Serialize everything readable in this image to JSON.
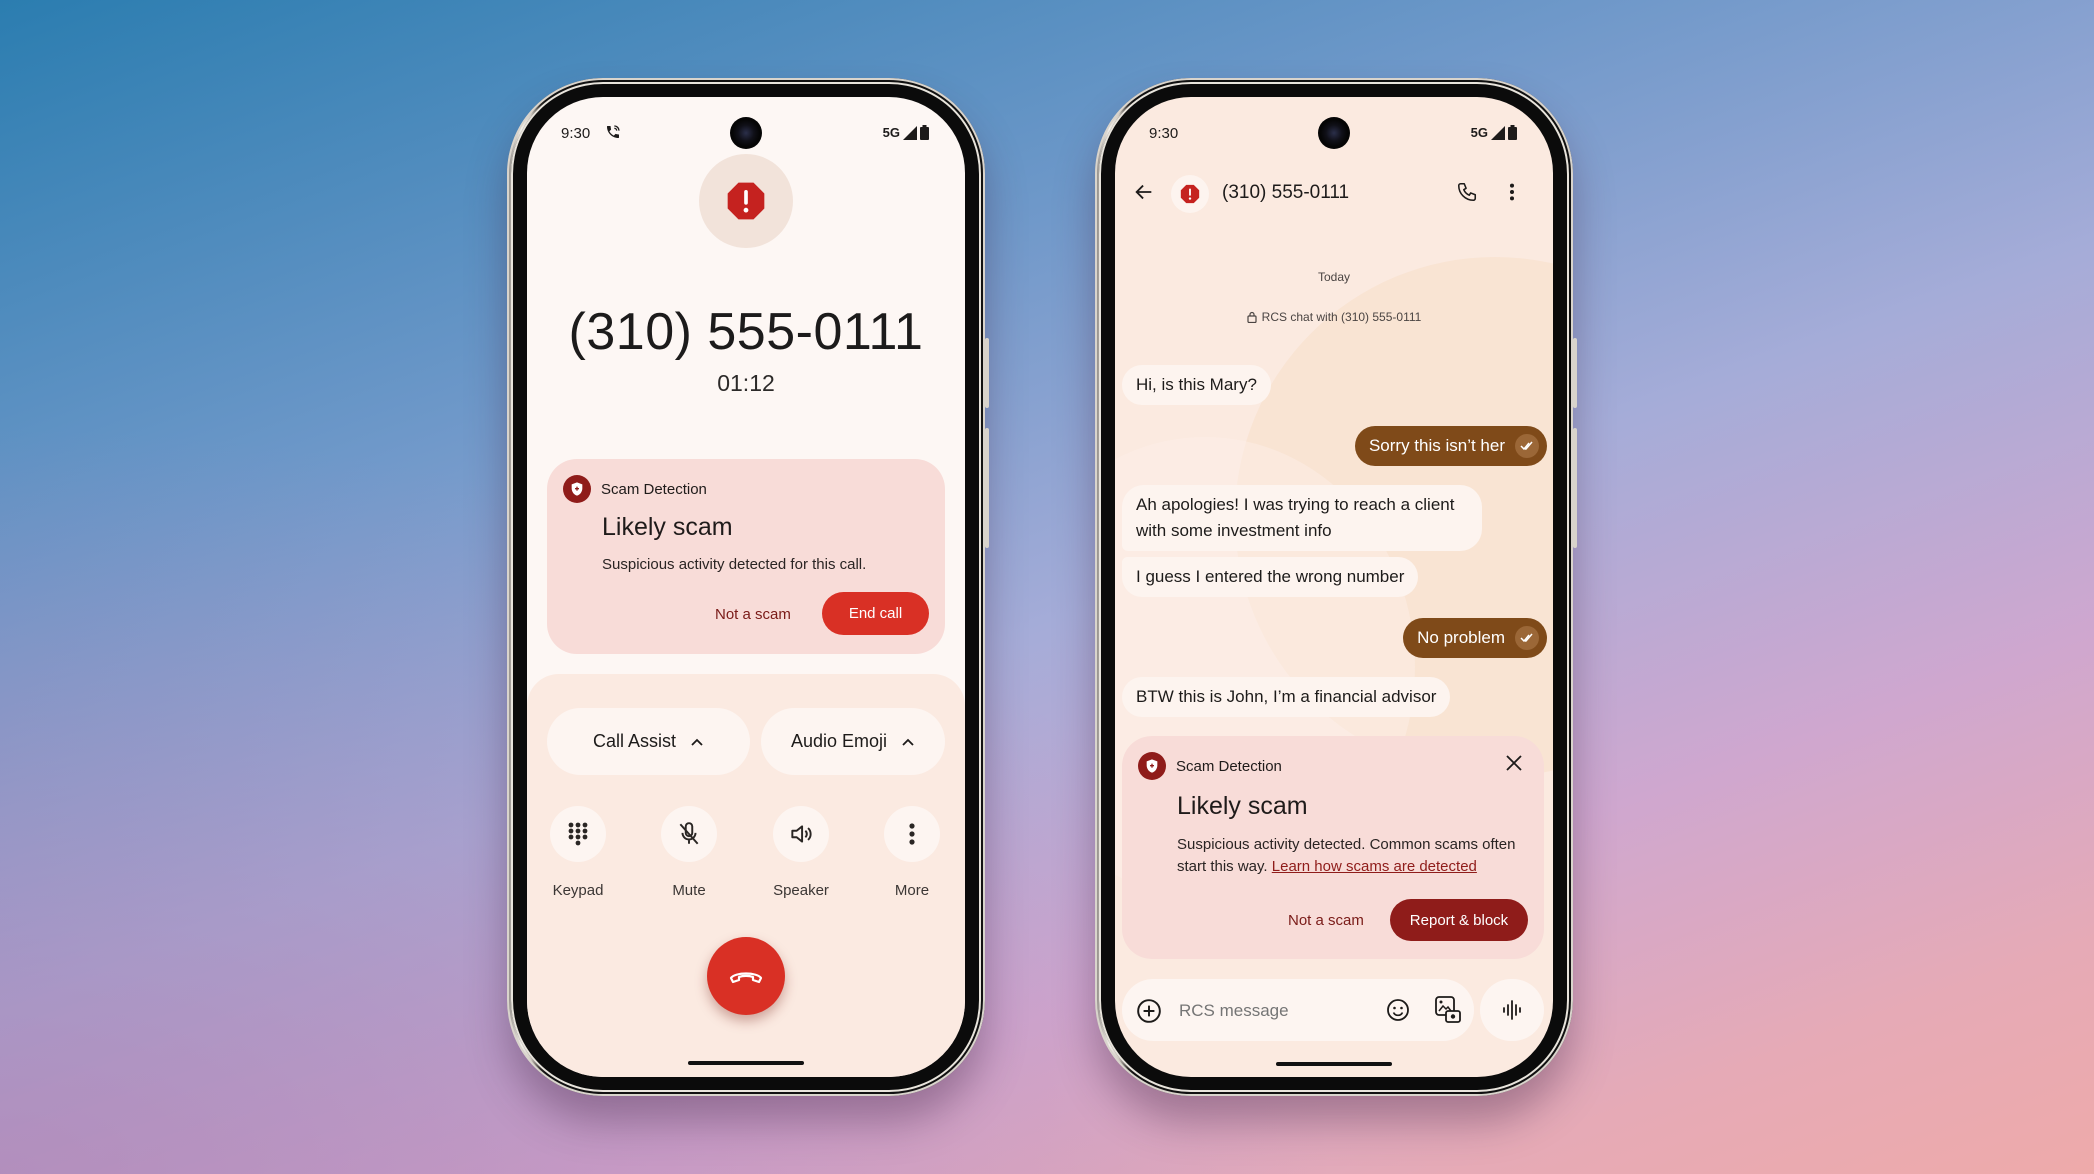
{
  "background": {
    "colors": [
      "#2b7db0",
      "#a5acd8",
      "#eeaaaa"
    ]
  },
  "call_screen": {
    "status": {
      "time": "9:30",
      "network": "5G"
    },
    "caller_number": "(310) 555-0111",
    "call_timer": "01:12",
    "scam_card": {
      "source": "Scam Detection",
      "title": "Likely scam",
      "description": "Suspicious activity detected for this call.",
      "secondary_action": "Not a scam",
      "primary_action": "End call"
    },
    "chips": [
      {
        "label": "Call Assist",
        "icon": "chevron-up-icon"
      },
      {
        "label": "Audio Emoji",
        "icon": "chevron-up-icon"
      }
    ],
    "controls": [
      {
        "label": "Keypad",
        "icon": "keypad-icon"
      },
      {
        "label": "Mute",
        "icon": "mic-off-icon"
      },
      {
        "label": "Speaker",
        "icon": "speaker-icon"
      },
      {
        "label": "More",
        "icon": "more-vert-icon"
      }
    ],
    "end_call_icon": "call-end-icon",
    "colors": {
      "danger": "#d93025",
      "card_bg": "#f8dcd8",
      "screen_bg": "#fdf7f4"
    }
  },
  "chat_screen": {
    "status": {
      "time": "9:30",
      "network": "5G"
    },
    "header": {
      "title": "(310) 555-0111",
      "back_icon": "arrow-back-icon",
      "call_icon": "phone-icon",
      "menu_icon": "more-vert-icon"
    },
    "date_divider": "Today",
    "encryption_notice": "RCS chat with (310) 555-0111",
    "messages": [
      {
        "direction": "in",
        "text": "Hi, is this Mary?"
      },
      {
        "direction": "out",
        "text": "Sorry this isn’t her",
        "status": "read"
      },
      {
        "direction": "in",
        "text": "Ah apologies! I was trying to reach a client with some investment info"
      },
      {
        "direction": "in",
        "text": "I guess I entered the wrong number"
      },
      {
        "direction": "out",
        "text": "No problem",
        "status": "read"
      },
      {
        "direction": "in",
        "text": "BTW this is John, I’m a financial advisor"
      }
    ],
    "scam_card": {
      "source": "Scam Detection",
      "title": "Likely scam",
      "description": "Suspicious activity detected. Common scams often start this way.",
      "link": "Learn how scams are detected",
      "secondary_action": "Not a scam",
      "primary_action": "Report & block"
    },
    "composer": {
      "placeholder": "RCS message"
    },
    "colors": {
      "outgoing_bubble": "#7f4a19",
      "primary_dark": "#8f1c1a",
      "screen_bg": "#fbeae0"
    }
  }
}
